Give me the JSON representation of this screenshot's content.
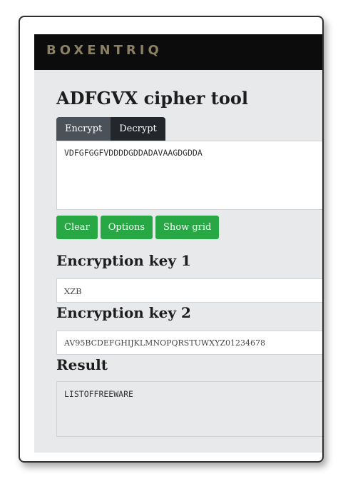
{
  "brand": "BOXENTRIQ",
  "page_title": "ADFGVX cipher tool",
  "tabs": [
    {
      "label": "Encrypt",
      "active": true
    },
    {
      "label": "Decrypt",
      "active": false
    }
  ],
  "input_text": "VDFGFGGFVDDDDGDDADAVAAGDGDDA",
  "buttons": {
    "clear": "Clear",
    "options": "Options",
    "show_grid": "Show grid"
  },
  "key1": {
    "label": "Encryption key 1",
    "value": "XZB"
  },
  "key2": {
    "label": "Encryption key 2",
    "value": "AV95BCDEFGHIJKLMNOPQRSTUWXYZ01234678"
  },
  "result": {
    "label": "Result",
    "value": "LISTOFFREEWARE"
  },
  "colors": {
    "header_bg": "#0c0c0c",
    "brand_text": "#8b8063",
    "button_green": "#28a745",
    "tab_bg": "#343a40",
    "content_bg": "#e8e9eb"
  }
}
